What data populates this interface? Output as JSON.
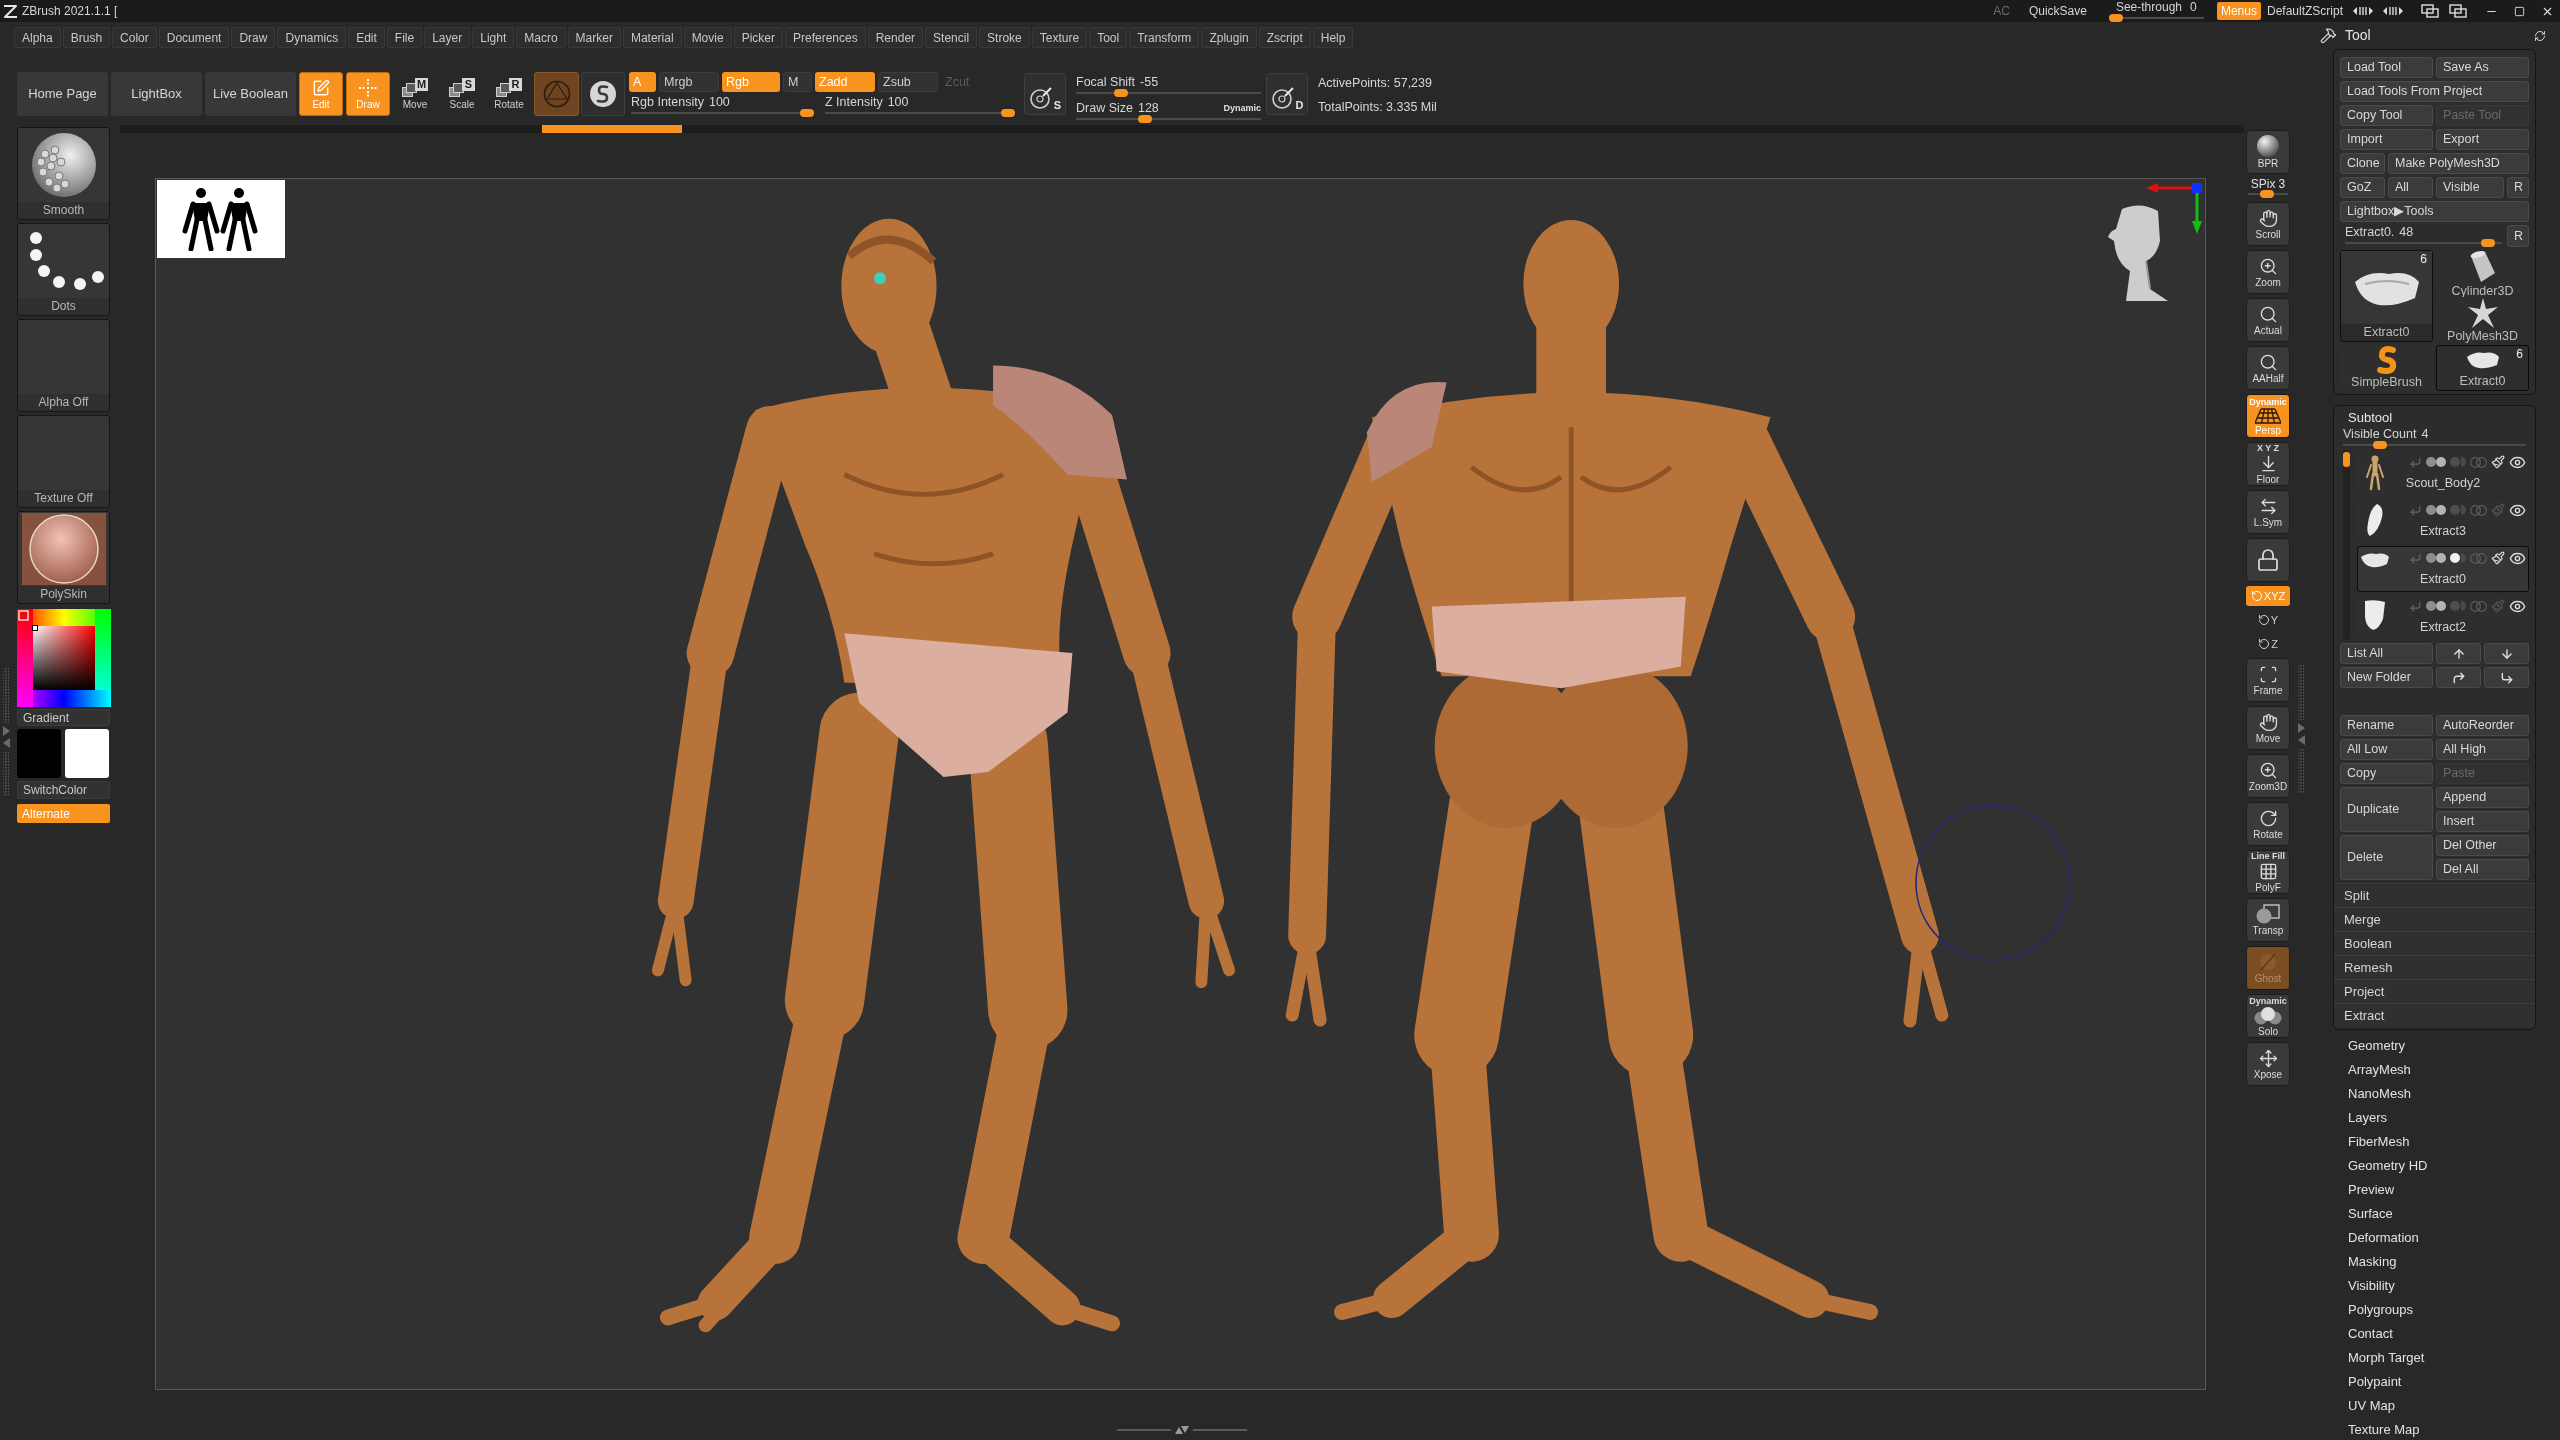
{
  "title_bar": {
    "title": "ZBrush 2021.1.1 [",
    "ac": "AC",
    "quicksave": "QuickSave",
    "see_through": {
      "label": "See-through",
      "value": "0",
      "level": 0
    },
    "menus": {
      "label": "Menus",
      "on": true
    },
    "script": "DefaultZScript"
  },
  "menu_bar": [
    "Alpha",
    "Brush",
    "Color",
    "Document",
    "Draw",
    "Dynamics",
    "Edit",
    "File",
    "Layer",
    "Light",
    "Macro",
    "Marker",
    "Material",
    "Movie",
    "Picker",
    "Preferences",
    "Render",
    "Stencil",
    "Stroke",
    "Texture",
    "Tool",
    "Transform",
    "Zplugin",
    "Zscript",
    "Help"
  ],
  "shelf": {
    "nav_buttons": [
      "Home Page",
      "LightBox",
      "Live Boolean"
    ],
    "modes": [
      {
        "label": "Edit",
        "on": true
      },
      {
        "label": "Draw",
        "on": true
      },
      {
        "label": "Move",
        "letter": "M",
        "on": false
      },
      {
        "label": "Scale",
        "letter": "S",
        "on": false
      },
      {
        "label": "Rotate",
        "letter": "R",
        "on": false
      }
    ],
    "channels": [
      {
        "label": "A",
        "on": true
      },
      {
        "label": "Mrgb",
        "on": false
      },
      {
        "label": "Rgb",
        "on": true
      },
      {
        "label": "M",
        "on": false
      }
    ],
    "depth_modes": [
      {
        "label": "Zadd",
        "on": true,
        "disabled": false
      },
      {
        "label": "Zsub",
        "on": false,
        "disabled": false
      },
      {
        "label": "Zcut",
        "on": false,
        "disabled": true
      }
    ],
    "rgb_intensity": {
      "label": "Rgb Intensity",
      "value": "100",
      "level": 1
    },
    "z_intensity": {
      "label": "Z Intensity",
      "value": "100",
      "level": 1
    },
    "focal_shift": {
      "icon_letter": "S",
      "label": "Focal Shift",
      "value": "-55",
      "level": 0.22
    },
    "draw_size": {
      "icon_letter": "D",
      "label": "Draw Size",
      "value": "128",
      "level": 0.36,
      "dynamic": "Dynamic"
    },
    "active_points": "ActivePoints: 57,239",
    "total_points": "TotalPoints: 3.335 Mil"
  },
  "left_shelf": {
    "slots": [
      {
        "kind": "brush",
        "label": "Smooth"
      },
      {
        "kind": "stroke",
        "label": "Dots"
      },
      {
        "kind": "alpha",
        "label": "Alpha Off"
      },
      {
        "kind": "texture",
        "label": "Texture Off"
      },
      {
        "kind": "material",
        "label": "PolySkin"
      }
    ],
    "gradient": "Gradient",
    "swatches": [
      {
        "color": "#000000"
      },
      {
        "color": "#ffffff"
      }
    ],
    "switch_color": "SwitchColor",
    "alternate": {
      "label": "Alternate",
      "on": true
    }
  },
  "nav_toolbar": [
    {
      "kind": "button",
      "label": "BPR",
      "on": false,
      "disabled": false
    },
    {
      "kind": "slider",
      "label": "SPix",
      "value": "3",
      "level": 0.45
    },
    {
      "kind": "button",
      "label": "Scroll",
      "on": false,
      "disabled": false
    },
    {
      "kind": "button",
      "label": "Zoom",
      "on": false,
      "disabled": false
    },
    {
      "kind": "button",
      "label": "Actual",
      "on": false,
      "disabled": false
    },
    {
      "kind": "button",
      "label": "AAHalf",
      "on": false,
      "disabled": false
    },
    {
      "kind": "button",
      "top_label": "Dynamic",
      "label": "Persp",
      "on": true,
      "disabled": false
    },
    {
      "kind": "button",
      "top_label": "X Y Z",
      "label": "Floor",
      "on": false,
      "disabled": false
    },
    {
      "kind": "button",
      "label": "L.Sym",
      "on": false,
      "disabled": false
    },
    {
      "kind": "button",
      "on": false,
      "disabled": false
    },
    {
      "kind": "axis",
      "label": "XYZ",
      "on": true,
      "disabled": false
    },
    {
      "kind": "axis",
      "label": "Y",
      "on": false,
      "disabled": false
    },
    {
      "kind": "axis",
      "label": "Z",
      "on": false,
      "disabled": false
    },
    {
      "kind": "button",
      "label": "Frame",
      "on": false,
      "disabled": false
    },
    {
      "kind": "button",
      "label": "Move",
      "on": false,
      "disabled": false
    },
    {
      "kind": "button",
      "label": "Zoom3D",
      "on": false,
      "disabled": false
    },
    {
      "kind": "button",
      "label": "Rotate",
      "on": false,
      "disabled": false
    },
    {
      "kind": "button",
      "top_label": "Line Fill",
      "label": "PolyF",
      "on": false,
      "disabled": false
    },
    {
      "kind": "button",
      "label": "Transp",
      "on": false,
      "disabled": false
    },
    {
      "kind": "button",
      "label": "Ghost",
      "on": true,
      "disabled": true
    },
    {
      "kind": "button",
      "top_label": "Dynamic",
      "label": "Solo",
      "on": false,
      "disabled": false
    },
    {
      "kind": "button",
      "label": "Xpose",
      "on": false,
      "disabled": false
    }
  ],
  "tool_panel": {
    "title": "Tool",
    "button_rows": [
      [
        {
          "label": "Load Tool",
          "disabled": false
        },
        {
          "label": "Save As",
          "disabled": false
        }
      ],
      [
        {
          "label": "Load Tools From Project",
          "disabled": false
        }
      ],
      [
        {
          "label": "Copy Tool",
          "disabled": false
        },
        {
          "label": "Paste Tool",
          "disabled": true
        }
      ],
      [
        {
          "label": "Import",
          "disabled": false
        },
        {
          "label": "Export",
          "disabled": false
        }
      ],
      [
        {
          "label": "Clone",
          "disabled": false
        },
        {
          "label": "Make PolyMesh3D",
          "disabled": false
        }
      ],
      [
        {
          "label": "GoZ",
          "disabled": false
        },
        {
          "label": "All",
          "disabled": false
        },
        {
          "label": "Visible",
          "disabled": false
        },
        {
          "label": "R",
          "disabled": false
        }
      ],
      [
        {
          "label": "Lightbox▶Tools",
          "disabled": false
        }
      ]
    ],
    "tool_slider": {
      "label": "Extract0.",
      "value": "48",
      "level": 0.95,
      "reset": "R"
    },
    "current_tool": {
      "name": "Extract0",
      "count": "6"
    },
    "recent_tools": [
      {
        "name": "Cylinder3D",
        "selected": false
      },
      {
        "name": "PolyMesh3D",
        "selected": false
      },
      {
        "name": "SimpleBrush",
        "selected": false
      },
      {
        "name": "Extract0",
        "count": "6",
        "selected": true
      }
    ]
  },
  "subtool_panel": {
    "title": "Subtool",
    "visible_count": {
      "label": "Visible Count",
      "value": "4",
      "level": 0.18
    },
    "subtools": [
      {
        "name": "Scout_Body2",
        "selected": false,
        "polypaint": true,
        "visible": true
      },
      {
        "name": "Extract3",
        "selected": false,
        "polypaint": false,
        "visible": true
      },
      {
        "name": "Extract0",
        "selected": true,
        "polypaint": true,
        "visible": true
      },
      {
        "name": "Extract2",
        "selected": false,
        "polypaint": false,
        "visible": true
      }
    ],
    "list_buttons": [
      "List All",
      "New Folder"
    ],
    "action_rows": [
      {
        "left": {
          "label": "Rename",
          "disabled": false
        },
        "right": [
          {
            "label": "AutoReorder",
            "disabled": false
          }
        ]
      },
      {
        "left": {
          "label": "All Low",
          "disabled": false
        },
        "right": [
          {
            "label": "All High",
            "disabled": false
          }
        ]
      },
      {
        "left": {
          "label": "Copy",
          "disabled": false
        },
        "right": [
          {
            "label": "Paste",
            "disabled": true
          }
        ]
      },
      {
        "left": {
          "label": "Duplicate",
          "disabled": false
        },
        "right": [
          {
            "label": "Append",
            "disabled": false
          },
          {
            "label": "Insert",
            "disabled": false
          }
        ]
      },
      {
        "left": {
          "label": "Delete",
          "disabled": false
        },
        "right": [
          {
            "label": "Del Other",
            "disabled": false
          },
          {
            "label": "Del All",
            "disabled": false
          }
        ]
      }
    ],
    "sections": [
      "Split",
      "Merge",
      "Boolean",
      "Remesh",
      "Project",
      "Extract"
    ]
  },
  "palettes": [
    "Geometry",
    "ArrayMesh",
    "NanoMesh",
    "Layers",
    "FiberMesh",
    "Geometry HD",
    "Preview",
    "Surface",
    "Deformation",
    "Masking",
    "Visibility",
    "Polygroups",
    "Contact",
    "Morph Target",
    "Polypaint",
    "UV Map",
    "Texture Map"
  ]
}
